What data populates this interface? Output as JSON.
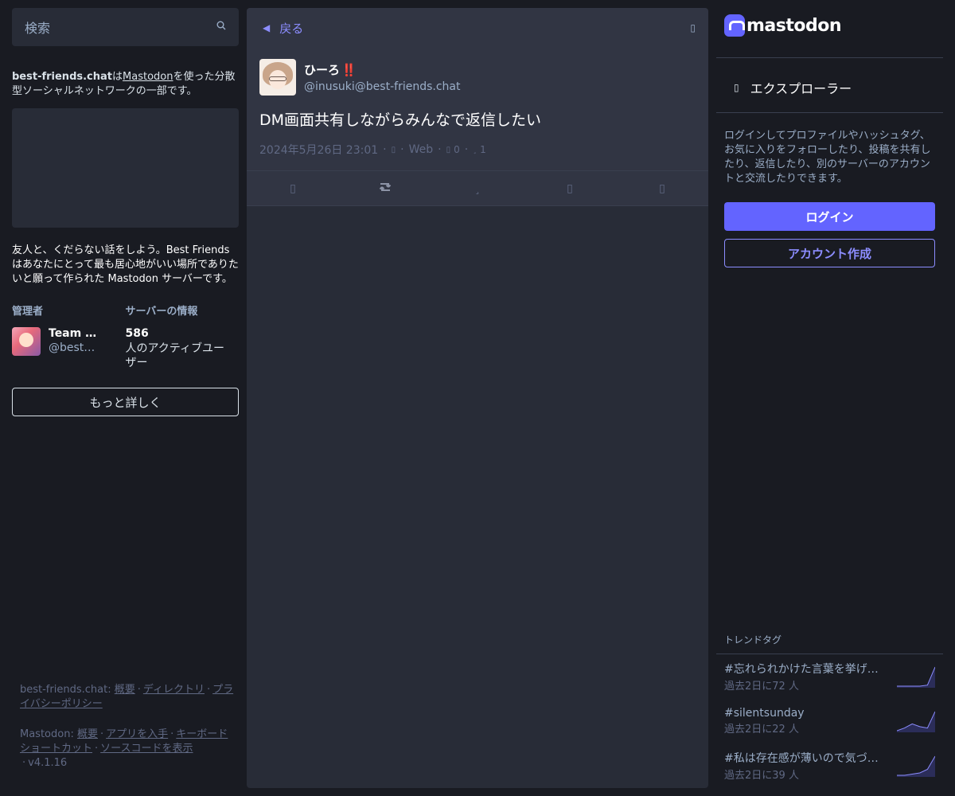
{
  "search": {
    "placeholder": "検索",
    "icon": "search-icon"
  },
  "server": {
    "domain": "best-friends.chat",
    "tagline_mid": "は",
    "software_link": "Mastodon",
    "tagline_end": "を使った分散型ソーシャルネットワークの一部です。",
    "description": "友人と、くだらない話をしよう。Best Friends はあなたにとって最も居心地がいい場所でありたいと願って作られた Mastodon サーバーです。",
    "admin_heading": "管理者",
    "admin_name": "Team B...",
    "admin_handle": "@best_...",
    "info_heading": "サーバーの情報",
    "active_users": "586",
    "active_users_label": "人のアクティブユーザー",
    "more_button": "もっと詳しく"
  },
  "footer": {
    "line1_prefix": "best-friends.chat:",
    "line1_links": [
      "概要",
      "ディレクトリ",
      "プライバシーポリシー"
    ],
    "line2_prefix": "Mastodon:",
    "line2_links": [
      "概要",
      "アプリを入手",
      "キーボードショートカット",
      "ソースコードを表示"
    ],
    "version": "v4.1.16"
  },
  "column": {
    "back_label": "戻る"
  },
  "status": {
    "display_name": "ひーろ",
    "display_name_emoji": "‼️",
    "acct": "@inusuki@best-friends.chat",
    "content": "DM画面共有しながらみんなで返信したい",
    "timestamp": "2024年5月26日 23:01",
    "application": "Web",
    "reblogs_count": "0",
    "favourites_count": "1"
  },
  "right": {
    "logo_text": "mastodon",
    "explore_label": "エクスプローラー",
    "login_description": "ログインしてプロファイルやハッシュタグ、お気に入りをフォローしたり、投稿を共有したり、返信したり、別のサーバーのアカウントと交流したりできます。",
    "login_button": "ログイン",
    "signup_button": "アカウント作成",
    "trends_title": "トレンドタグ",
    "trends": [
      {
        "tag": "#忘れられかけた言葉を挙げていこう",
        "uses": "過去2日に72 人",
        "spark": [
          0,
          0,
          0,
          0,
          1,
          18
        ]
      },
      {
        "tag": "#silentsunday",
        "uses": "過去2日に22 人",
        "spark": [
          0,
          2,
          5,
          3,
          2,
          14
        ]
      },
      {
        "tag": "#私は存在感が薄いので気づかれない",
        "uses": "過去2日に39 人",
        "spark": [
          0,
          0,
          1,
          2,
          5,
          16
        ]
      }
    ]
  },
  "colors": {
    "accent": "#6364ff",
    "link": "#8c8dff",
    "bg": "#191b22",
    "panel": "#282c37"
  }
}
